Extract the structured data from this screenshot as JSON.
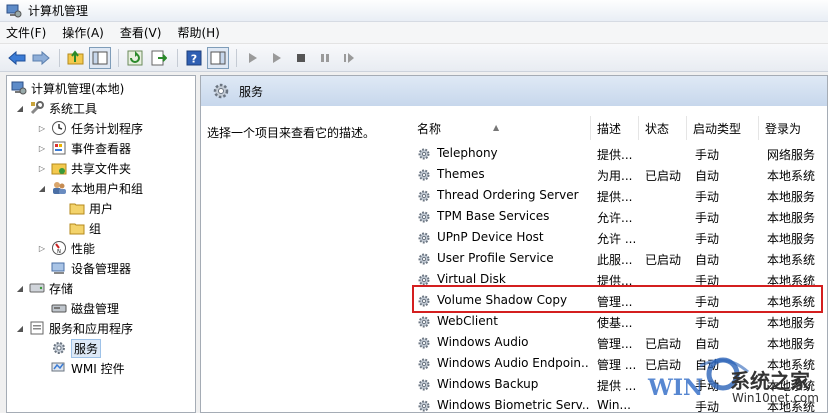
{
  "window": {
    "title": "计算机管理"
  },
  "menubar": {
    "items": [
      "文件(F)",
      "操作(A)",
      "查看(V)",
      "帮助(H)"
    ]
  },
  "tree": {
    "items": [
      {
        "label": "计算机管理(本地)"
      },
      {
        "label": "系统工具"
      },
      {
        "label": "任务计划程序"
      },
      {
        "label": "事件查看器"
      },
      {
        "label": "共享文件夹"
      },
      {
        "label": "本地用户和组"
      },
      {
        "label": "用户"
      },
      {
        "label": "组"
      },
      {
        "label": "性能"
      },
      {
        "label": "设备管理器"
      },
      {
        "label": "存储"
      },
      {
        "label": "磁盘管理"
      },
      {
        "label": "服务和应用程序"
      },
      {
        "label": "服务"
      },
      {
        "label": "WMI 控件"
      }
    ]
  },
  "pane": {
    "title": "服务",
    "description": "选择一个项目来查看它的描述。"
  },
  "columns": {
    "name": "名称",
    "desc": "描述",
    "status": "状态",
    "startup": "启动类型",
    "logon": "登录为"
  },
  "services": [
    {
      "name": "Telephony",
      "desc": "提供...",
      "status": "",
      "startup": "手动",
      "logon": "网络服务"
    },
    {
      "name": "Themes",
      "desc": "为用...",
      "status": "已启动",
      "startup": "自动",
      "logon": "本地系统"
    },
    {
      "name": "Thread Ordering Server",
      "desc": "提供...",
      "status": "",
      "startup": "手动",
      "logon": "本地服务"
    },
    {
      "name": "TPM Base Services",
      "desc": "允许...",
      "status": "",
      "startup": "手动",
      "logon": "本地服务"
    },
    {
      "name": "UPnP Device Host",
      "desc": "允许 ...",
      "status": "",
      "startup": "手动",
      "logon": "本地服务"
    },
    {
      "name": "User Profile Service",
      "desc": "此服...",
      "status": "已启动",
      "startup": "自动",
      "logon": "本地系统"
    },
    {
      "name": "Virtual Disk",
      "desc": "提供...",
      "status": "",
      "startup": "手动",
      "logon": "本地系统"
    },
    {
      "name": "Volume Shadow Copy",
      "desc": "管理...",
      "status": "",
      "startup": "手动",
      "logon": "本地系统"
    },
    {
      "name": "WebClient",
      "desc": "使基...",
      "status": "",
      "startup": "手动",
      "logon": "本地服务"
    },
    {
      "name": "Windows Audio",
      "desc": "管理...",
      "status": "已启动",
      "startup": "自动",
      "logon": "本地服务"
    },
    {
      "name": "Windows Audio Endpoin...",
      "desc": "管理 ...",
      "status": "已启动",
      "startup": "自动",
      "logon": "本地系统"
    },
    {
      "name": "Windows Backup",
      "desc": "提供 ...",
      "status": "",
      "startup": "手动",
      "logon": "本地系统"
    },
    {
      "name": "Windows Biometric Serv...",
      "desc": "Win...",
      "status": "",
      "startup": "手动",
      "logon": "本地系统"
    }
  ],
  "watermark": {
    "logo": "WIN",
    "site_cn": "系统之家",
    "site_url": "Win10net.com"
  },
  "colors": {
    "highlight": "#d41f1f",
    "header": "#c7d7ec"
  }
}
